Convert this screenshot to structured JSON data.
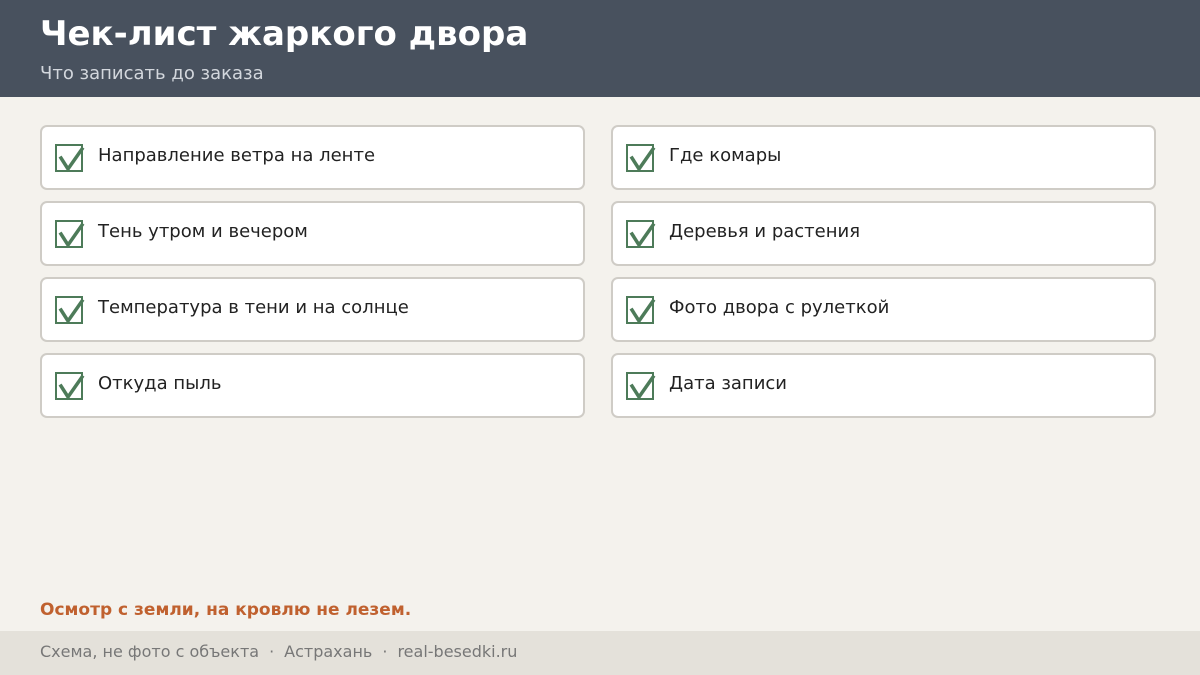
{
  "header": {
    "title": "Чек-лист жаркого двора",
    "subtitle": "Что записать до заказа"
  },
  "checklist": {
    "items": [
      {
        "label": "Направление ветра на ленте",
        "checked": true
      },
      {
        "label": "Где комары",
        "checked": true
      },
      {
        "label": "Тень утром и вечером",
        "checked": true
      },
      {
        "label": "Деревья и растения",
        "checked": true
      },
      {
        "label": "Температура в тени и на солнце",
        "checked": true
      },
      {
        "label": "Фото двора с рулеткой",
        "checked": true
      },
      {
        "label": "Откуда пыль",
        "checked": true
      },
      {
        "label": "Дата записи",
        "checked": true
      }
    ]
  },
  "note": "Осмотр с земли, на кровлю не лезем.",
  "footer": {
    "part1": "Схема, не фото с объекта",
    "separator": "·",
    "part2": "Астрахань",
    "part3": "real-besedki.ru"
  },
  "colors": {
    "header_bg": "#48515e",
    "check": "#4d7b59",
    "accent_note": "#c0612f"
  }
}
